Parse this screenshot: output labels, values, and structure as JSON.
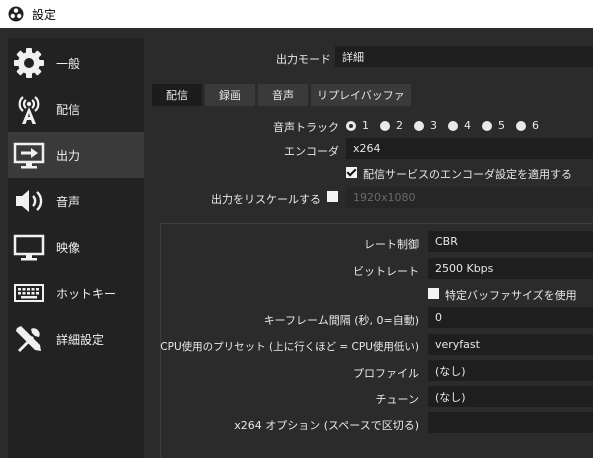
{
  "window": {
    "title": "設定"
  },
  "sidebar": {
    "items": [
      {
        "label": "一般",
        "icon": "gear-icon"
      },
      {
        "label": "配信",
        "icon": "broadcast-icon"
      },
      {
        "label": "出力",
        "icon": "output-icon",
        "active": true
      },
      {
        "label": "音声",
        "icon": "speaker-icon"
      },
      {
        "label": "映像",
        "icon": "monitor-icon"
      },
      {
        "label": "ホットキー",
        "icon": "keyboard-icon"
      },
      {
        "label": "詳細設定",
        "icon": "tools-icon"
      }
    ]
  },
  "output_mode": {
    "label": "出力モード",
    "value": "詳細"
  },
  "tabs": [
    "配信",
    "録画",
    "音声",
    "リプレイバッファ"
  ],
  "audio_track": {
    "label": "音声トラック",
    "options": [
      "1",
      "2",
      "3",
      "4",
      "5",
      "6"
    ],
    "selected": "1"
  },
  "encoder": {
    "label": "エンコーダ",
    "value": "x264"
  },
  "apply_service_settings": {
    "label": "配信サービスのエンコーダ設定を適用する",
    "checked": true
  },
  "rescale": {
    "label": "出力をリスケールする",
    "checked": false,
    "value": "1920x1080"
  },
  "rate_control": {
    "label": "レート制御",
    "value": "CBR"
  },
  "bitrate": {
    "label": "ビットレート",
    "value": "2500 Kbps"
  },
  "custom_buffer": {
    "label": "特定バッファサイズを使用",
    "checked": false
  },
  "keyframe": {
    "label": "キーフレーム間隔 (秒, 0=自動)",
    "value": "0"
  },
  "cpu_preset": {
    "label": "CPU使用のプリセット (上に行くほど = CPU使用低い)",
    "value": "veryfast"
  },
  "profile": {
    "label": "プロファイル",
    "value": "(なし)"
  },
  "tune": {
    "label": "チューン",
    "value": "(なし)"
  },
  "x264_options": {
    "label": "x264 オプション (スペースで区切る)",
    "value": ""
  }
}
